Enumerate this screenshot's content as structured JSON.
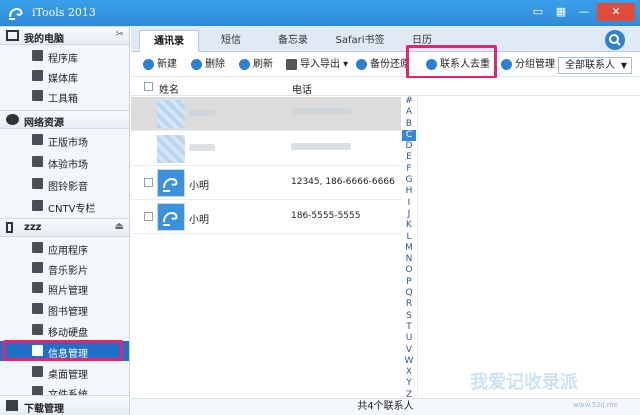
{
  "app": {
    "title": "iTools 2013"
  },
  "sidebar": {
    "my_computer": "我的电脑",
    "computer_items": [
      "程序库",
      "媒体库",
      "工具箱"
    ],
    "network": "网络资源",
    "network_items": [
      "正版市场",
      "体验市场",
      "图铃影音",
      "CNTV专栏"
    ],
    "device": "zzz",
    "device_items": [
      "应用程序",
      "音乐影片",
      "照片管理",
      "图书管理",
      "移动硬盘",
      "信息管理",
      "桌面管理",
      "文件系统"
    ],
    "download": "下载管理"
  },
  "tabs": [
    "通讯录",
    "短信",
    "备忘录",
    "Safari书签",
    "日历"
  ],
  "toolbar": {
    "new": "新建",
    "delete": "删除",
    "refresh": "刷新",
    "import_export": "导入导出",
    "backup": "备份还原",
    "dedupe": "联系人去重",
    "group": "分组管理",
    "filter": "全部联系人"
  },
  "columns": {
    "name": "姓名",
    "phone": "电话"
  },
  "contacts": [
    {
      "name": "",
      "phone": ""
    },
    {
      "name": "",
      "phone": ""
    },
    {
      "name": "小明",
      "phone": "12345, 186-6666-6666"
    },
    {
      "name": "小明",
      "phone": "186-5555-5555"
    }
  ],
  "alphabet": [
    "#",
    "A",
    "B",
    "C",
    "D",
    "E",
    "F",
    "G",
    "H",
    "I",
    "J",
    "K",
    "L",
    "M",
    "N",
    "O",
    "P",
    "Q",
    "R",
    "S",
    "T",
    "U",
    "V",
    "W",
    "X",
    "Y",
    "Z"
  ],
  "alphabet_selected": "C",
  "status": "共4个联系人",
  "watermark": "我爱记收录派",
  "watermark_url": "www.52ij.me",
  "colors": {
    "accent": "#2f8ad6",
    "highlight": "#e8226e",
    "selected": "#1e70c8"
  }
}
